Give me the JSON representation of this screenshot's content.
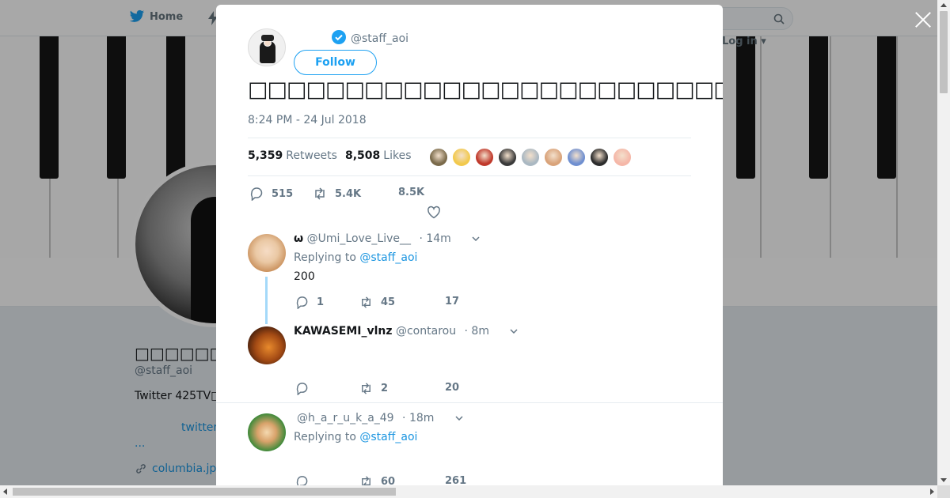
{
  "nav": {
    "home_label": "Home",
    "login_label": "Log in"
  },
  "profile": {
    "name": "□□□□□□□",
    "handle": "@staff_aoi",
    "bio": "Twitter  425TV□",
    "bio_link": "twitter",
    "more": "...",
    "url": "columbia.jp"
  },
  "tweet": {
    "handle": "@staff_aoi",
    "follow_label": "Follow",
    "text": "□□□□□□□□□□□□□□□□□□□□□□□□□□□□□□□□□□□□□□□□□□□□□□□□□□□□□□□□□□□□□□□□□□□□□□□□□□",
    "time": "8:24 PM - 24 Jul 2018",
    "retweets_count": "5,359",
    "retweets_label": "Retweets",
    "likes_count": "8,508",
    "likes_label": "Likes",
    "likers": [
      "#7a6a4a",
      "#f2c94c",
      "#c0392b",
      "#3a3a3a",
      "#aab8c2",
      "#d9a37a",
      "#6f8fd0",
      "#2c2c2c",
      "#f5b7a8"
    ],
    "actions": {
      "replies": "515",
      "retweets": "5.4K",
      "likes": "8.5K"
    }
  },
  "replies": [
    {
      "name": "ω",
      "handle": "@Umi_Love_Live__",
      "time": "· 14m",
      "replying_prefix": "Replying to",
      "replying_to": "@staff_aoi",
      "text": "200",
      "counts": {
        "replies": "1",
        "retweets": "45",
        "likes": "17"
      }
    },
    {
      "name": "KAWASEMI_vlnz",
      "handle": "@contarou",
      "time": "· 8m",
      "counts": {
        "replies": "",
        "retweets": "2",
        "likes": "20"
      }
    },
    {
      "name": "",
      "handle": "@h_a_r_u_k_a_49",
      "time": "· 18m",
      "replying_prefix": "Replying to",
      "replying_to": "@staff_aoi",
      "counts": {
        "replies": "",
        "retweets": "60",
        "likes": "261"
      }
    }
  ],
  "colors": {
    "accent": "#1da1f2",
    "link": "#1b95e0",
    "muted": "#657786",
    "thread": "#a4d9f9"
  }
}
